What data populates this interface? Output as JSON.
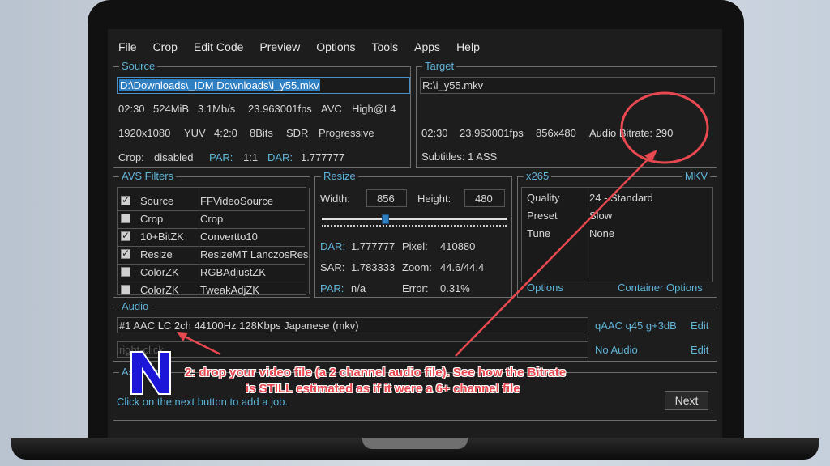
{
  "menu": [
    "File",
    "Crop",
    "Edit Code",
    "Preview",
    "Options",
    "Tools",
    "Apps",
    "Help"
  ],
  "source": {
    "title": "Source",
    "path": "D:\\Downloads\\_IDM Downloads\\i_y55.mkv",
    "line1": [
      "02:30",
      "524MiB",
      "3.1Mb/s",
      "23.963001fps",
      "AVC",
      "High@L4"
    ],
    "line2": [
      "1920x1080",
      "YUV",
      "4:2:0",
      "8Bits",
      "SDR",
      "Progressive"
    ],
    "crop_label": "Crop:",
    "crop_value": "disabled",
    "par_label": "PAR:",
    "par_value": "1:1",
    "dar_label": "DAR:",
    "dar_value": "1.777777"
  },
  "target": {
    "title": "Target",
    "path": "R:\\i_y55.mkv",
    "line": [
      "02:30",
      "23.963001fps",
      "856x480",
      "Audio Bitrate: 290"
    ],
    "subtitles": "Subtitles: 1 ASS"
  },
  "avs": {
    "title": "AVS Filters",
    "rows": [
      {
        "checked": true,
        "name": "Source",
        "value": "FFVideoSource"
      },
      {
        "checked": false,
        "name": "Crop",
        "value": "Crop"
      },
      {
        "checked": true,
        "name": "10+BitZK",
        "value": "Convertto10"
      },
      {
        "checked": true,
        "name": "Resize",
        "value": "ResizeMT LanczosRes"
      },
      {
        "checked": false,
        "name": "ColorZK",
        "value": "RGBAdjustZK"
      },
      {
        "checked": false,
        "name": "ColorZK",
        "value": "TweakAdjZK"
      }
    ]
  },
  "resize": {
    "title": "Resize",
    "width_label": "Width:",
    "width_value": "856",
    "height_label": "Height:",
    "height_value": "480",
    "slider_level": 0.34,
    "dar_label": "DAR:",
    "dar_value": "1.777777",
    "pixel_label": "Pixel:",
    "pixel_value": "410880",
    "sar_label": "SAR:",
    "sar_value": "1.783333",
    "zoom_label": "Zoom:",
    "zoom_value": "44.6/44.4",
    "par_label": "PAR:",
    "par_value": "n/a",
    "error_label": "Error:",
    "error_value": "0.31%"
  },
  "x265": {
    "title": "x265",
    "container": "MKV",
    "rows": [
      {
        "name": "Quality",
        "value": "24 - Standard"
      },
      {
        "name": "Preset",
        "value": "Slow"
      },
      {
        "name": "Tune",
        "value": "None"
      }
    ],
    "options_link": "Options",
    "container_options_link": "Container Options"
  },
  "audio": {
    "title": "Audio",
    "track1": "#1 AAC LC 2ch 44100Hz 128Kbps Japanese (mkv)",
    "track1_profile": "qAAC q45 g+3dB",
    "track1_edit": "Edit",
    "track2_placeholder": "right-click",
    "track2_profile": "No Audio",
    "track2_edit": "Edit"
  },
  "assistant": {
    "title": "Assistant",
    "hint": "Click on the next button to add a job.",
    "next_label": "Next"
  },
  "caption": {
    "line1": "2: drop your video file (a 2 channel audio file). See how the Bitrate",
    "line2": "is STILL estimated as if it were a 6+ channel file"
  },
  "colors": {
    "accent": "#5fb4d8",
    "annotation": "#e8484f",
    "selection": "#2f7fc3"
  }
}
